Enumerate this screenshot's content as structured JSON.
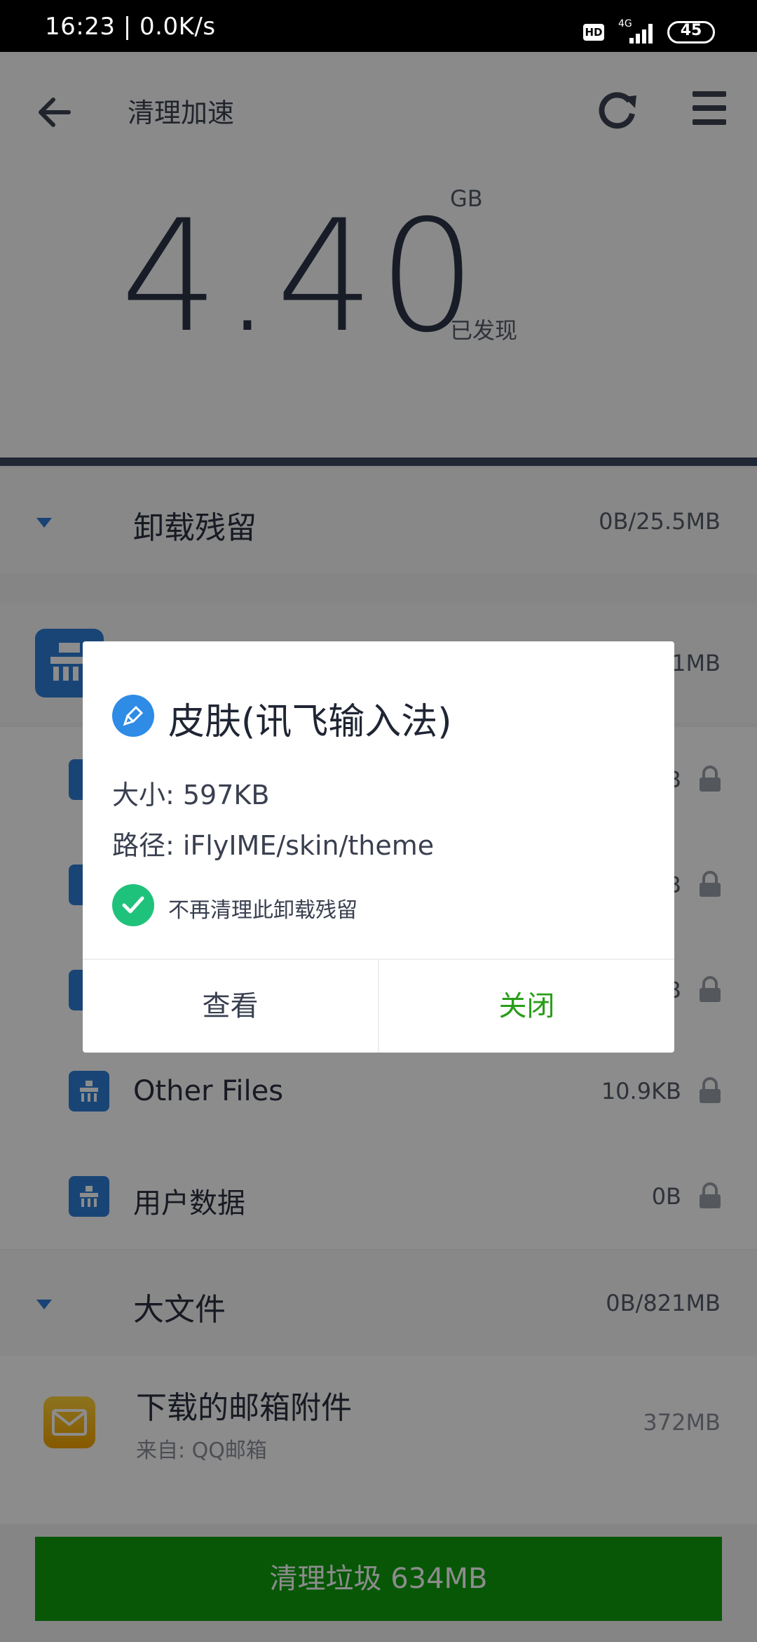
{
  "status_bar": {
    "time": "16:23 | 0.0K/s",
    "hd": "HD",
    "network": "4G",
    "battery": "45"
  },
  "header": {
    "title": "清理加速",
    "amount": "4.40",
    "unit": "GB",
    "found_label": "已发现",
    "progress": 1.0
  },
  "sections": [
    {
      "title": "卸载残留",
      "size": "0B/25.5MB"
    },
    {
      "title": "大文件",
      "size": "0B/821MB"
    }
  ],
  "rows": {
    "hidden_group_size": "31MB",
    "row_a_size": "B",
    "row_b_size": "B",
    "row_c_size": "B",
    "other_files_label": "Other Files",
    "other_files_size": "10.9KB",
    "user_data_label": "用户数据",
    "user_data_size": "0B"
  },
  "mail_item": {
    "title": "下载的邮箱附件",
    "subtitle": "来自: QQ邮箱",
    "size": "372MB"
  },
  "clean_button": "清理垃圾 634MB",
  "dialog": {
    "title": "皮肤(讯飞输入法)",
    "size_line": "大小: 597KB",
    "path_line": "路径: iFlyIME/skin/theme",
    "checkbox_label": "不再清理此卸载残留",
    "view_button": "查看",
    "close_button": "关闭"
  },
  "colors": {
    "accent_blue": "#2f7fd8",
    "primary_green": "#0e9e0e",
    "close_green": "#2a9d1a",
    "check_green": "#1fc27a"
  }
}
